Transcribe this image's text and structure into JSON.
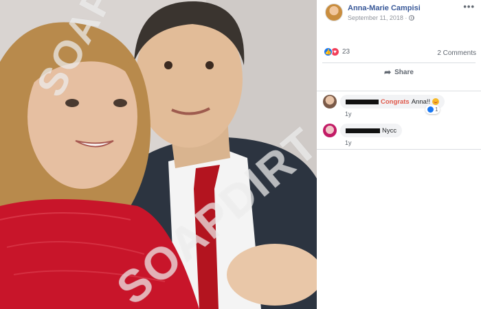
{
  "photo": {
    "alt": "Selfie of a smiling woman in a red lace dress and a man in a dark suit with a red tie",
    "watermark_text": "SOAPDIRT"
  },
  "post": {
    "author": "Anna-Marie Campisi",
    "date": "September 11, 2018 · ",
    "more_icon": "•••",
    "reaction_count": "23",
    "comment_count": "2 Comments",
    "share_label": "Share"
  },
  "comments": [
    {
      "mention": "Congrats",
      "text": "Anna!!",
      "reaction_count": "1",
      "time": "1y"
    },
    {
      "text": "Nycc",
      "time": "1y"
    }
  ],
  "colors": {
    "link": "#385898",
    "like": "#1877f2",
    "love": "#f33e58",
    "mention": "#e0584a"
  }
}
